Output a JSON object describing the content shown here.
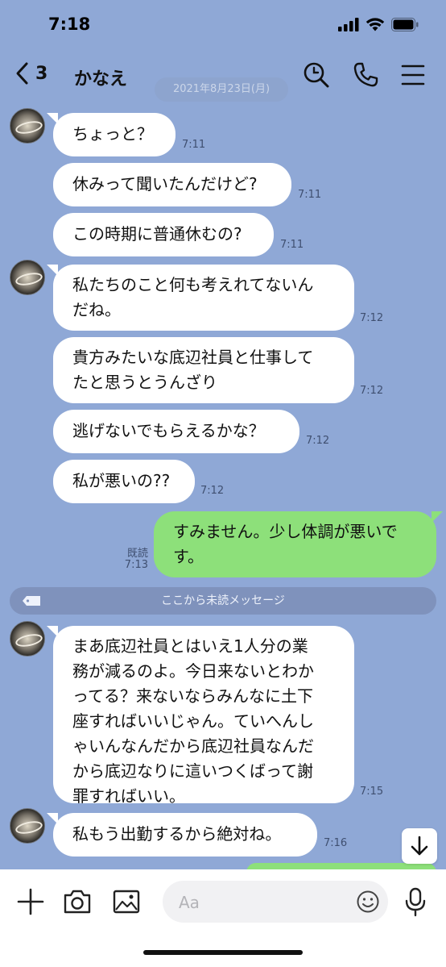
{
  "status_bar": {
    "time": "7:18"
  },
  "header": {
    "back_count": "3",
    "title": "かなえ"
  },
  "date_divider": "2021年8月23日(月)",
  "messages": [
    {
      "lines": [
        "ちょっと？"
      ],
      "time": "7:11"
    },
    {
      "lines": [
        "休みって聞いたんだけど?"
      ],
      "time": "7:11"
    },
    {
      "lines": [
        "この時期に普通休むの?"
      ],
      "time": "7:11"
    },
    {
      "lines": [
        "私たちのこと何も考えれてないん",
        "だね。"
      ],
      "time": "7:12"
    },
    {
      "lines": [
        "貴方みたいな底辺社員と仕事して",
        "たと思うとうんざり"
      ],
      "time": "7:12"
    },
    {
      "lines": [
        "逃げないでもらえるかな？"
      ],
      "time": "7:12"
    },
    {
      "lines": [
        "私が悪いの??"
      ],
      "time": "7:12"
    },
    {
      "lines": [
        "すみません。少し体調が悪いで",
        "す。"
      ],
      "time": "7:13",
      "read": "既読"
    },
    {
      "lines": [
        "まあ底辺社員とはいえ1人分の業",
        "務が減るのよ。今日来ないとわか",
        "ってる？来ないならみんなに土下",
        "座すればいいじゃん。ていへんし",
        "ゃいんなんだから底辺社員なんだ",
        "から底辺なりに這いつくばって謝",
        "罪すればいい。"
      ],
      "time": "7:15"
    },
    {
      "lines": [
        "私もう出勤するから絶対ね。"
      ],
      "time": "7:16"
    }
  ],
  "unread_divider": "ここから未読メッセージ",
  "input": {
    "placeholder": "Aa"
  },
  "icons": [
    "signal-icon",
    "wifi-icon",
    "battery-icon",
    "back-chevron-icon",
    "search-icon",
    "phone-icon",
    "menu-icon",
    "plus-icon",
    "camera-icon",
    "image-icon",
    "emoji-icon",
    "mic-icon",
    "arrow-down-icon"
  ],
  "colors": {
    "background": "#8fa8d6",
    "outgoing_bubble": "#8de07a",
    "incoming_bubble": "#ffffff"
  }
}
